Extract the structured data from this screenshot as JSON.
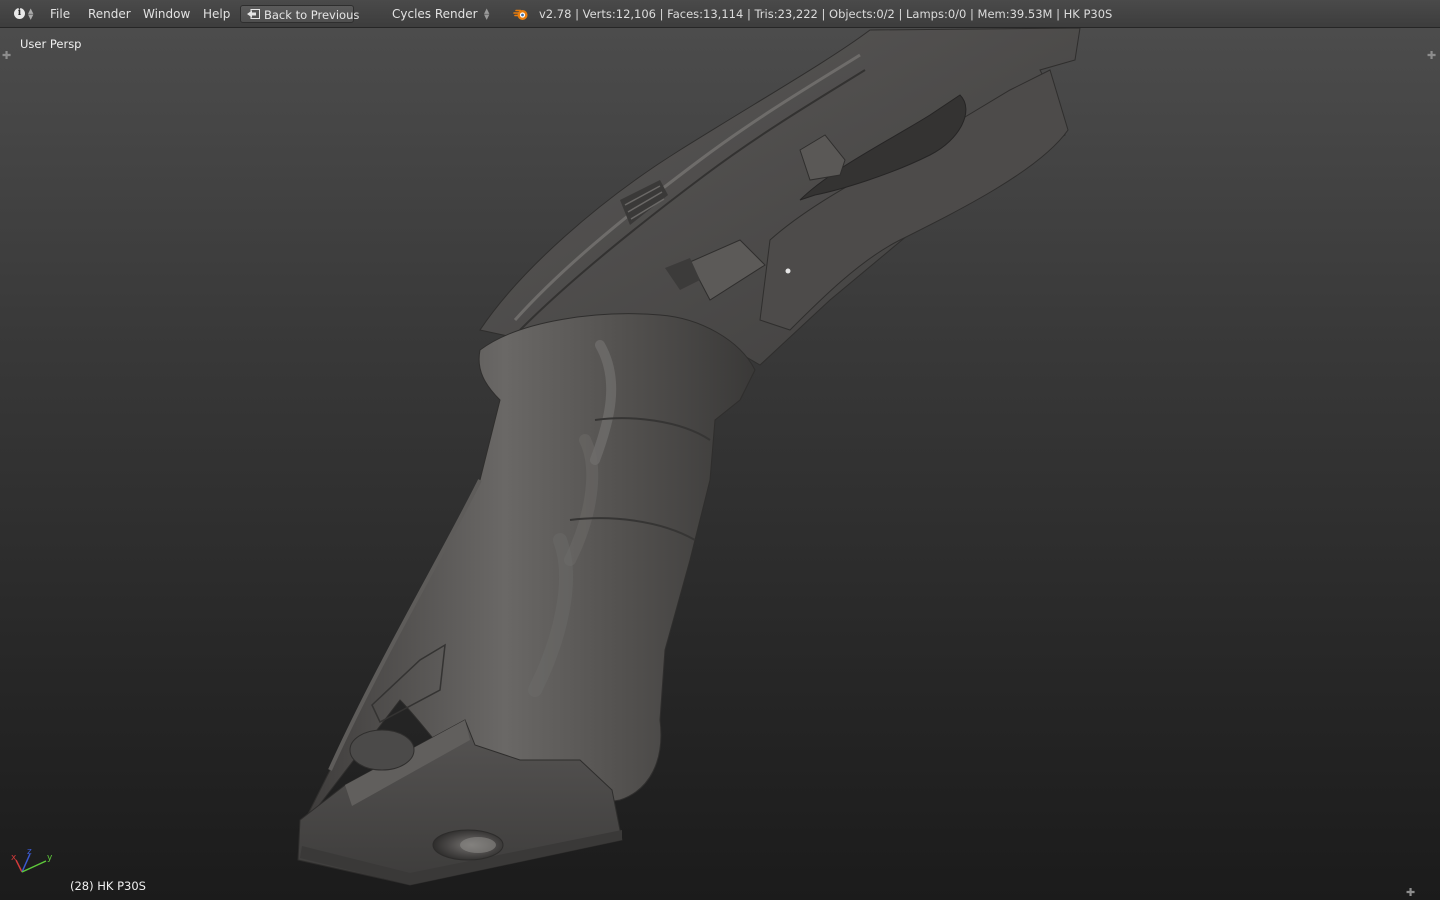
{
  "header": {
    "editor_type_icon": "info-icon",
    "menus": {
      "file": "File",
      "render": "Render",
      "window": "Window",
      "help": "Help"
    },
    "back_button": {
      "icon": "back-arrow-icon",
      "label": "Back to Previous"
    },
    "render_engine": {
      "selected": "Cycles Render"
    },
    "app_logo": "blender-logo-icon",
    "stats": "v2.78 | Verts:12,106 | Faces:13,114 | Tris:23,222 | Objects:0/2 | Lamps:0/0 | Mem:39.53M | HK P30S"
  },
  "viewport": {
    "view_name": "User Persp",
    "active_object": "(28) HK P30S",
    "axis_gizmo": {
      "x": "x",
      "y": "y",
      "z": "z"
    },
    "colors": {
      "mesh": "#4a4a4a",
      "background_top": "#4c4c4c",
      "background_bottom": "#1b1b1b",
      "axis_x": "#d23a3a",
      "axis_y": "#5ec93b",
      "axis_z": "#3b5ad2"
    }
  }
}
